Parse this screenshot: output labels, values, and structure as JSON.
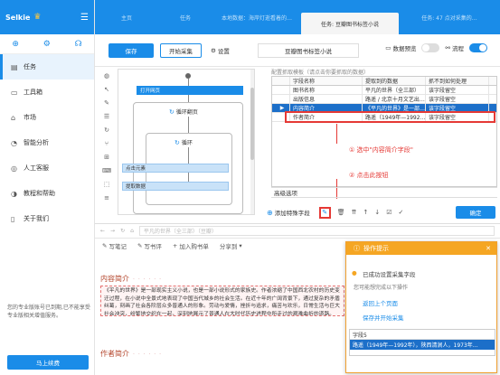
{
  "app": {
    "name": "Selkie",
    "crown_icon": "crown-icon",
    "menu_icon": "hamburger-icon"
  },
  "sidebar": {
    "top_icons": [
      "plus-icon",
      "gear-icon",
      "headset-icon"
    ],
    "items": [
      {
        "label": "任务",
        "icon": "document-icon",
        "active": true
      },
      {
        "label": "工具箱",
        "icon": "toolbox-icon",
        "active": false
      },
      {
        "label": "市场",
        "icon": "store-icon",
        "active": false
      },
      {
        "label": "智能分析",
        "icon": "chart-icon",
        "active": false
      },
      {
        "label": "人工客服",
        "icon": "chat-icon",
        "active": false
      },
      {
        "label": "教程和帮助",
        "icon": "help-icon",
        "active": false
      },
      {
        "label": "关于我们",
        "icon": "info-icon",
        "active": false
      }
    ],
    "note": "您的专业版账号已到期,已不能享受专业版相关增值服务。",
    "upgrade_label": "马上续费"
  },
  "tabs": [
    {
      "label": "主页",
      "active": false
    },
    {
      "label": "任务",
      "active": false
    },
    {
      "label": "本地数据：海岸灯逝看着的…",
      "active": false
    },
    {
      "label": "任务: 豆瓣图书标签小说",
      "active": true
    },
    {
      "label": "任务: 47 点对采集的…",
      "active": false
    }
  ],
  "toolbar": {
    "save_label": "保存",
    "start_label": "开始采集",
    "settings_label": "设置",
    "task_name": "豆瓣图书标签小说",
    "data_preview_label": "数据预览",
    "flow_label": "流程"
  },
  "flow": {
    "open_page": "打开网页",
    "pagination_loop": "循环翻页",
    "loop": "循环",
    "click_element": "点击元素",
    "extract_data": "提取数据"
  },
  "config": {
    "title": "配置抓取模板（请点击你要抓取的数据）",
    "columns": [
      "字段名称",
      "提取到的数据",
      "抓不到如何处理"
    ],
    "rows": [
      {
        "name": "图书名称",
        "value": "平凡的世界（全三部）",
        "handling": "该字段留空",
        "selected": false
      },
      {
        "name": "出版信息",
        "value": "路遥 / 北京十月文艺出…",
        "handling": "该字段留空",
        "selected": false
      },
      {
        "name": "内容简介",
        "value": "《平凡的世界》是一部…",
        "handling": "该字段留空",
        "selected": true
      },
      {
        "name": "作者简介",
        "value": "路遥（1949年—1992…",
        "handling": "该字段留空",
        "selected": false
      }
    ],
    "annotation1": "① 选中\"内容简介字段\"",
    "annotation2": "② 点击此按钮",
    "advanced_label": "高级选项",
    "add_special_field": "添加特殊字段",
    "confirm_label": "确定"
  },
  "browser": {
    "url": "平凡的世界（全三部）（豆瓣）",
    "actions": [
      "写笔记",
      "写书评",
      "加入购书单",
      "分享到"
    ],
    "intro_title": "内容简介",
    "intro_dash": "· · · · · ·",
    "intro_text": "《平凡的世界》是一部现实主义小说，也是一部小说形式的家族史。作者浓缩了中国西北农村的历史变迁过程，在小说中全景式地表现了中国当代城乡的社会生活。在近十年的广阔背景下，通过复杂的矛盾纠葛，刻画了社会各阶层众多普通人的形象。劳动与爱情，挫折与追求，痛苦与欢乐，日常生活与巨大社会冲突，纷繁地交织在一起，深刻地展示了普通人在大时代历史进程中所走过的艰难曲折的道路。",
    "author_title": "作者简介",
    "author_dash": "· · · · · ·"
  },
  "tip": {
    "title": "操作提示",
    "success": "已成功设置采集字段",
    "question": "您可能想完成以下操作",
    "link1": "返回上个页面",
    "link2": "保存并开始采集",
    "list_header": "字段5",
    "list_value": "路遥（1949年—1992年），陕西清涧人，1973年…"
  }
}
